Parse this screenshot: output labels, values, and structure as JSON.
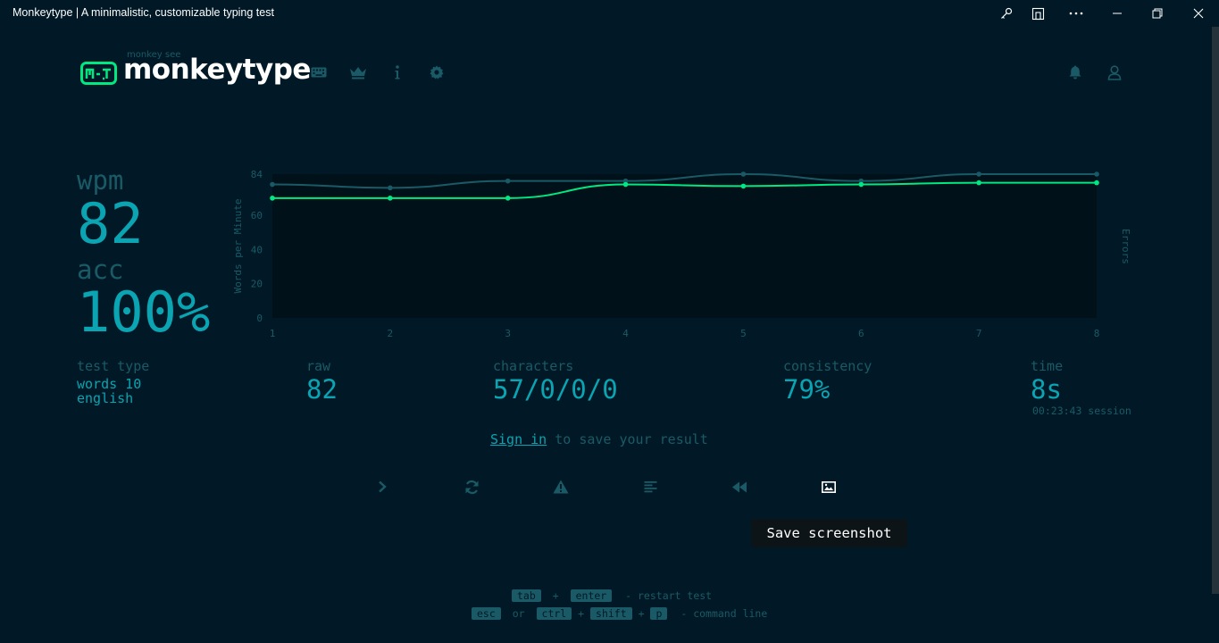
{
  "window": {
    "title": "Monkeytype | A minimalistic, customizable typing test"
  },
  "header": {
    "logo_sub": "monkey see",
    "logo_text": "monkeytype",
    "nav_icons": [
      "keyboard-icon",
      "crown-icon",
      "info-icon",
      "gear-icon"
    ],
    "right_icons": [
      "bell-icon",
      "user-icon"
    ]
  },
  "result": {
    "wpm_label": "wpm",
    "wpm_value": "82",
    "acc_label": "acc",
    "acc_value": "100%",
    "test_type_label": "test type",
    "test_type_mode": "words 10",
    "test_type_lang": "english",
    "raw_label": "raw",
    "raw_value": "82",
    "characters_label": "characters",
    "characters_value": "57/0/0/0",
    "consistency_label": "consistency",
    "consistency_value": "79%",
    "time_label": "time",
    "time_value": "8s",
    "session_text": "00:23:43 session"
  },
  "signin": {
    "link": "Sign in",
    "rest": " to save your result"
  },
  "actions": [
    "next-test-icon",
    "restart-icon",
    "warning-icon",
    "words-history-icon",
    "replay-icon",
    "screenshot-icon"
  ],
  "tooltip": "Save screenshot",
  "hints": {
    "row1": {
      "keys": [
        "tab",
        "enter"
      ],
      "sep": "+",
      "text": "- restart test"
    },
    "row2": {
      "k1": "esc",
      "or": "or",
      "k2": "ctrl",
      "k3": "shift",
      "k4": "p",
      "plus": "+",
      "text": "- command line"
    }
  },
  "colors": {
    "background": "#011926",
    "main": "#0aa4b2",
    "sub": "#1a5a66",
    "wpm_line": "#00e980",
    "raw_line": "#1a5a66"
  },
  "chart_data": {
    "type": "line",
    "title": "",
    "xlabel": "",
    "ylabel": "Words per Minute",
    "y2label": "Errors",
    "x": [
      1,
      2,
      3,
      4,
      5,
      6,
      7,
      8
    ],
    "yticks": [
      0,
      20,
      40,
      60,
      84
    ],
    "ylim": [
      0,
      84
    ],
    "series": [
      {
        "values": [
          70,
          70,
          70,
          78,
          77,
          78,
          79,
          79
        ],
        "color": "#00e980"
      },
      {
        "values": [
          78,
          76,
          80,
          80,
          84,
          80,
          84,
          84
        ],
        "color": "#1a5a66"
      }
    ]
  }
}
